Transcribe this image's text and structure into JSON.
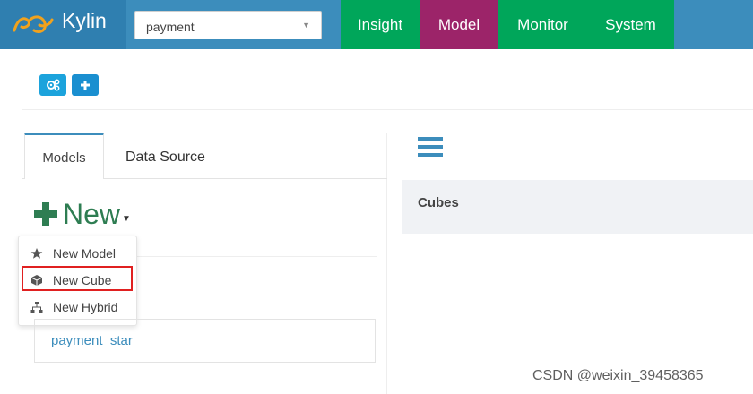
{
  "navbar": {
    "brand": "Kylin",
    "project_select": "payment",
    "tabs": [
      {
        "label": "Insight"
      },
      {
        "label": "Model"
      },
      {
        "label": "Monitor"
      },
      {
        "label": "System"
      }
    ],
    "active_tab": "Model",
    "colors": {
      "navbar": "#3c8dbc",
      "tab": "#00a65a",
      "active_tab": "#9c2469"
    }
  },
  "toolbar": {
    "icons": [
      "cogs-icon",
      "plus-icon"
    ]
  },
  "left_panel": {
    "tabs": [
      {
        "label": "Models"
      },
      {
        "label": "Data Source"
      }
    ],
    "new_button": "New",
    "dropdown": [
      {
        "label": "New Model",
        "icon": "star-icon"
      },
      {
        "label": "New Cube",
        "icon": "cube-icon",
        "highlighted": true
      },
      {
        "label": "New Hybrid",
        "icon": "hierarchy-icon"
      }
    ],
    "models": [
      "payment_star"
    ]
  },
  "right_panel": {
    "section_title": "Cubes"
  },
  "watermark": "CSDN @weixin_39458365"
}
